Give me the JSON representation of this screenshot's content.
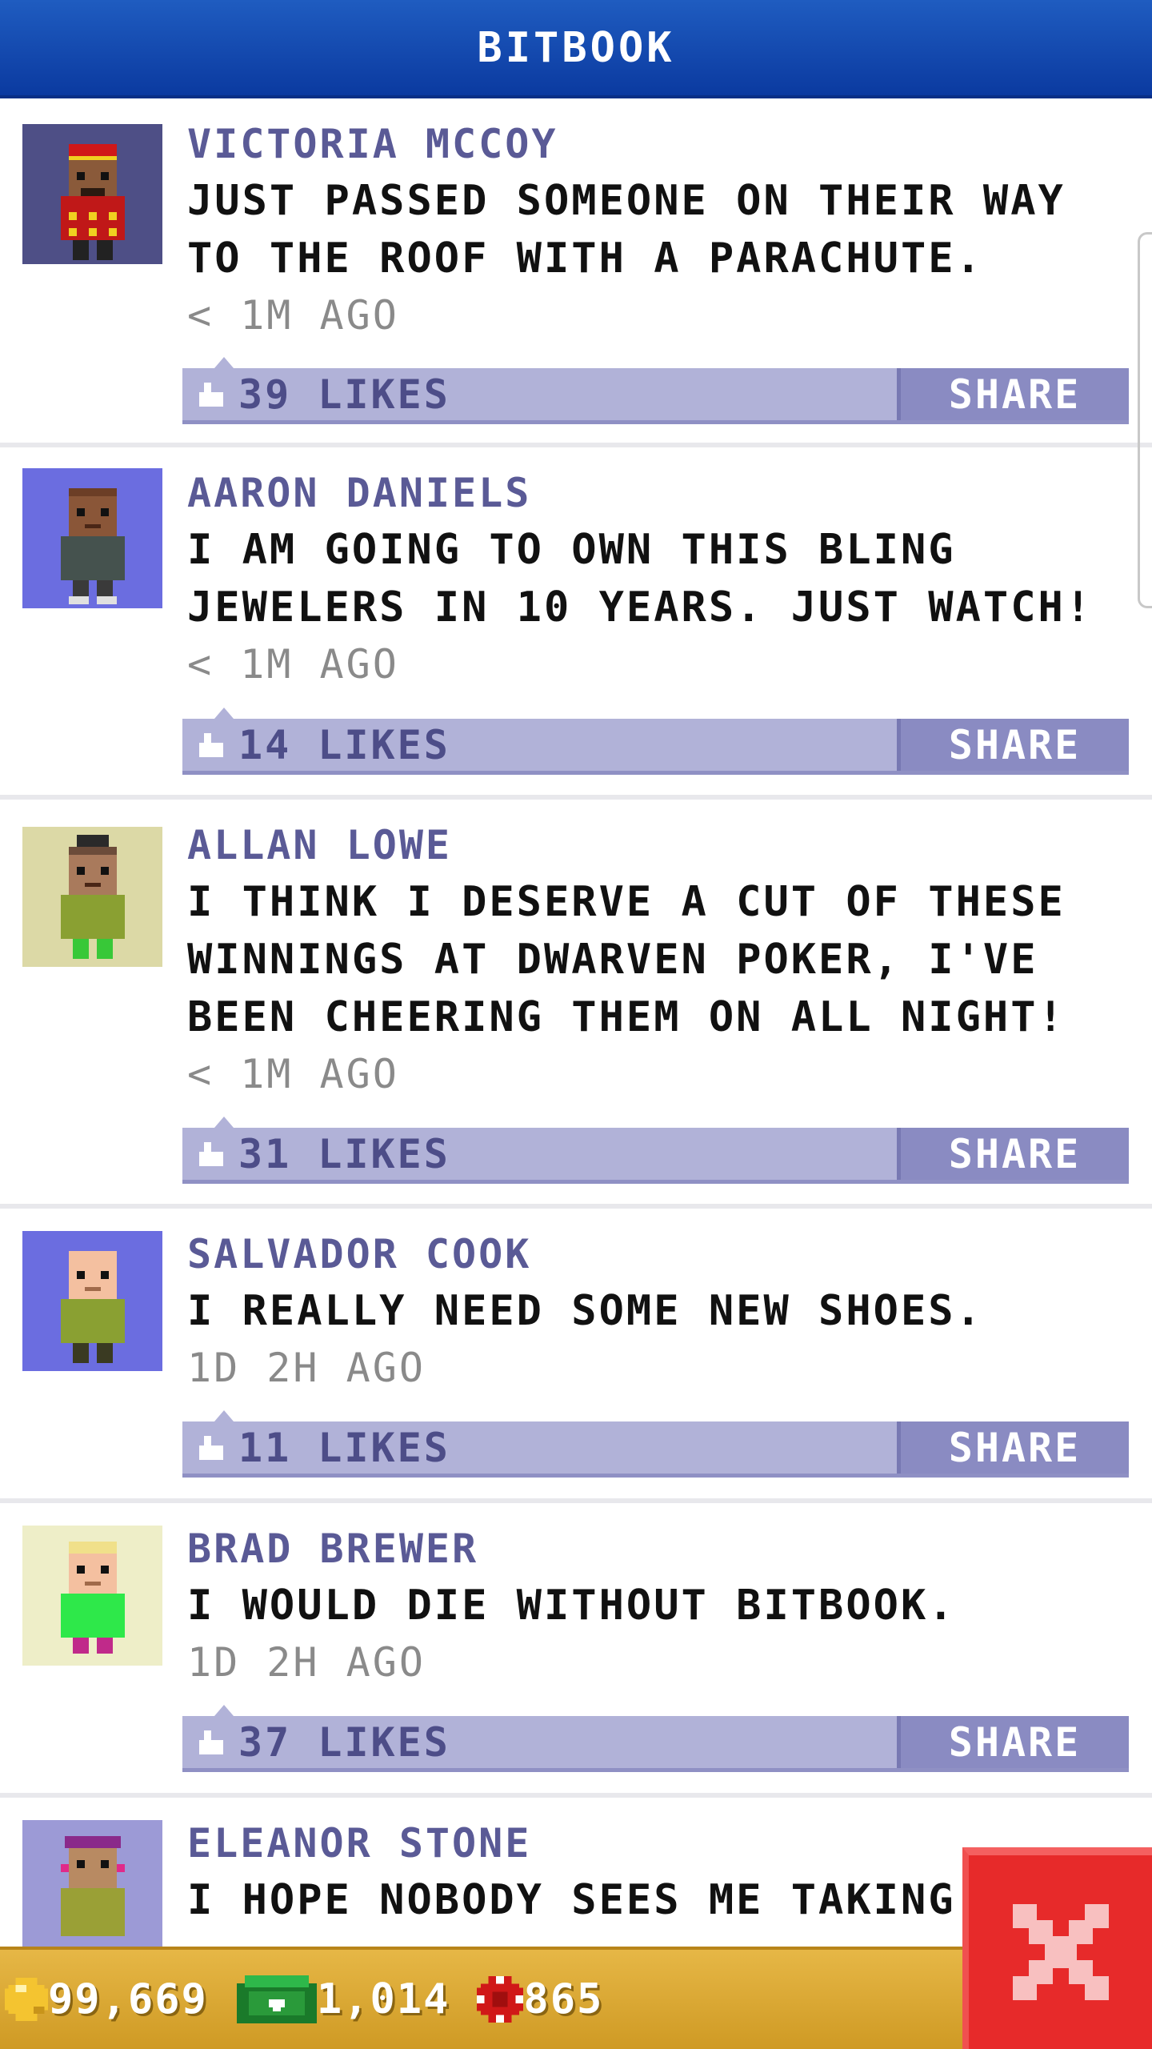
{
  "header": {
    "title": "BITBOOK"
  },
  "posts": [
    {
      "author": "VICTORIA MCCOY",
      "message": "JUST PASSED SOMEONE ON THEIR WAY TO THE ROOF WITH A PARACHUTE.",
      "time": "< 1M AGO",
      "likes": "39 LIKES",
      "share": "SHARE",
      "avatar_bg": "#4e4f86"
    },
    {
      "author": "AARON DANIELS",
      "message": "I AM GOING TO OWN THIS BLING JEWELERS IN 10 YEARS. JUST WATCH!",
      "time": "< 1M AGO",
      "likes": "14 LIKES",
      "share": "SHARE",
      "avatar_bg": "#6b6de0"
    },
    {
      "author": "ALLAN LOWE",
      "message": "I THINK I DESERVE A CUT OF THESE WINNINGS AT DWARVEN POKER, I'VE BEEN CHEERING THEM ON ALL NIGHT!",
      "time": "< 1M AGO",
      "likes": "31 LIKES",
      "share": "SHARE",
      "avatar_bg": "#dcd9a6"
    },
    {
      "author": "SALVADOR COOK",
      "message": "I REALLY NEED SOME NEW SHOES.",
      "time": "1D 2H AGO",
      "likes": "11 LIKES",
      "share": "SHARE",
      "avatar_bg": "#6b6de0"
    },
    {
      "author": "BRAD BREWER",
      "message": "I WOULD DIE WITHOUT BITBOOK.",
      "time": "1D 2H AGO",
      "likes": "37 LIKES",
      "share": "SHARE",
      "avatar_bg": "#eeeec8"
    },
    {
      "author": "ELEANOR STONE",
      "message": "I HOPE NOBODY SEES ME TAKING",
      "avatar_bg": "#9c9ad6"
    }
  ],
  "bottom_bar": {
    "coins": "99,669",
    "bux": "1,014",
    "chips": "865"
  },
  "icons": {
    "like": "thumbs-up-icon",
    "coin": "gold-coin-icon",
    "bux": "bitbux-icon",
    "chip": "poker-chip-icon",
    "close": "close-icon"
  }
}
